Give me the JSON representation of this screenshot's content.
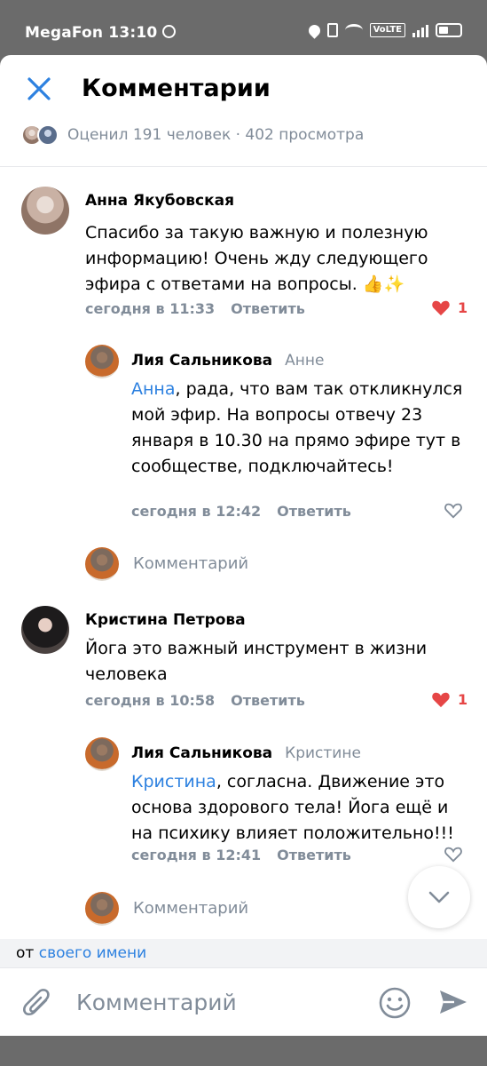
{
  "status_bar": {
    "carrier_time": "MegaFon 13:10",
    "volte": "VoLTE"
  },
  "header": {
    "title": "Комментарии",
    "likes_views": "Оценил 191 человек · 402 просмотра"
  },
  "comments": [
    {
      "author": "Анна Якубовская",
      "text": "Спасибо за такую важную и полезную информацию! Очень жду следующего эфира с ответами на вопросы. 👍✨",
      "time": "сегодня в 11:33",
      "reply_label": "Ответить",
      "likes": "1",
      "reply": {
        "author": "Лия Сальникова",
        "reply_to": "Анне",
        "mention": "Анна",
        "text": ", рада, что вам так откликнулся мой эфир. На вопросы отвечу 23 января в 10.30 на прямо эфире тут в  сообществе, подключайтесь!",
        "time": "сегодня в 12:42",
        "reply_label": "Ответить"
      },
      "comment_field": "Комментарий"
    },
    {
      "author": "Кристина Петрова",
      "text": "Йога это важный инструмент  в жизни человека",
      "time": "сегодня в 10:58",
      "reply_label": "Ответить",
      "likes": "1",
      "reply": {
        "author": "Лия Сальникова",
        "reply_to": "Кристине",
        "mention": "Кристина",
        "text": ", согласна. Движение это основа здорового тела! Йога ещё и на психику влияет положительно!!!",
        "time": "сегодня в 12:41",
        "reply_label": "Ответить"
      },
      "comment_field": "Комментарий"
    }
  ],
  "footer": {
    "from_prefix": "от ",
    "from_link": "своего имени",
    "input_placeholder": "Комментарий"
  },
  "colors": {
    "accent": "#2d81e0",
    "like": "#e64646",
    "secondary": "#818c99"
  }
}
